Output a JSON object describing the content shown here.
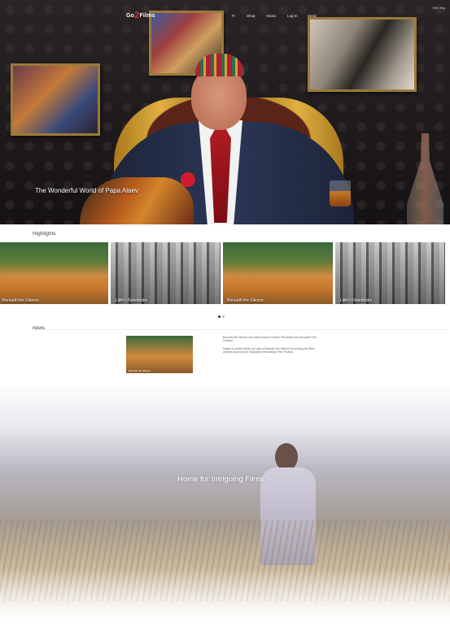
{
  "nav": {
    "logo_prefix": "Go",
    "logo_number": "2",
    "logo_suffix": "Films",
    "items": [
      "Fi",
      "Shop",
      "About",
      "Log In",
      "Send"
    ],
    "language": "Heb | Eng"
  },
  "hero": {
    "caption": "The Wonderful World of Papa Alaev"
  },
  "highlights": {
    "title": "Highlights",
    "slides": [
      {
        "caption": "Beneath the Silence",
        "style": "color"
      },
      {
        "caption": "Lilith's Notebooks",
        "style": "bw"
      },
      {
        "caption": "Beneath the Silence",
        "style": "color"
      },
      {
        "caption": "Lilith's Notebooks",
        "style": "bw"
      }
    ],
    "active_dot": 0
  },
  "news": {
    "title": "news",
    "thumb_caption": "Beneath the Silence",
    "paragraph_1": "Beneath the Silence won Best Actress Feature Film Award at Sunnyville Film Festival",
    "paragraph_2": "Maybe to Ashlee Bolts, the star of Beneath the Silence for winning the Best Actress Award at the Shanghai International Film Festival"
  },
  "footer": {
    "tagline": "Home for Intriguing Films"
  }
}
